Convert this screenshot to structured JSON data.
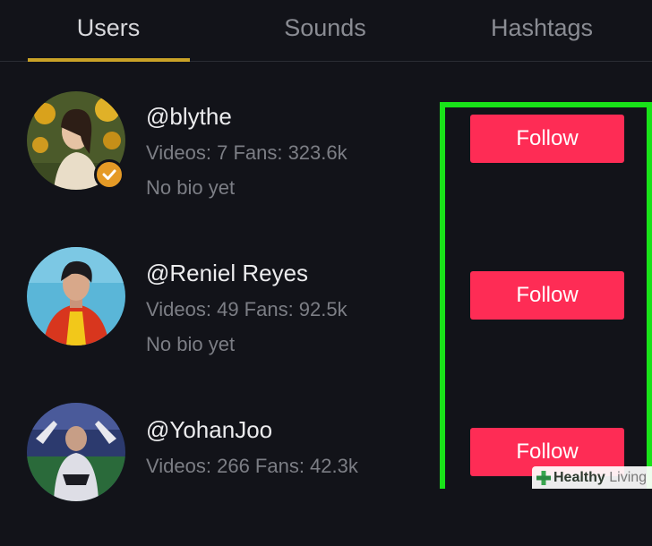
{
  "tabs": [
    {
      "label": "Users",
      "active": true
    },
    {
      "label": "Sounds",
      "active": false
    },
    {
      "label": "Hashtags",
      "active": false
    }
  ],
  "users": [
    {
      "username": "@blythe",
      "stats": "Videos: 7 Fans: 323.6k",
      "bio": "No bio yet",
      "verified": true,
      "follow_label": "Follow"
    },
    {
      "username": "@Reniel Reyes",
      "stats": "Videos: 49 Fans: 92.5k",
      "bio": "No bio yet",
      "verified": false,
      "follow_label": "Follow"
    },
    {
      "username": "@YohanJoo",
      "stats": "Videos: 266 Fans: 42.3k",
      "bio": "",
      "verified": false,
      "follow_label": "Follow"
    }
  ],
  "watermark": {
    "brand_bold": "Healthy",
    "brand_light": "Living"
  },
  "colors": {
    "background": "#121319",
    "accent_tab": "#c9a227",
    "follow_button": "#fe2c55",
    "highlight": "#19e219",
    "verified_badge": "#e59a26"
  }
}
